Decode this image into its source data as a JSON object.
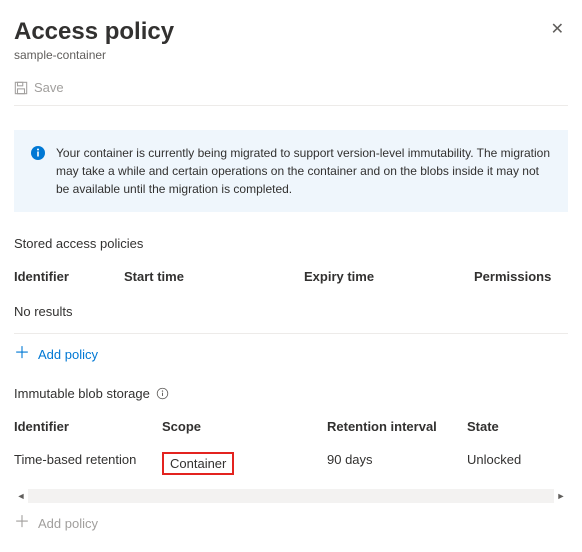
{
  "header": {
    "title": "Access policy",
    "subtitle": "sample-container"
  },
  "toolbar": {
    "save_label": "Save"
  },
  "notice": {
    "text": "Your container is currently being migrated to support version-level immutability. The migration may take a while and certain operations on the container and on the blobs inside it may not be available until the migration is completed."
  },
  "storedAccessPolicies": {
    "title": "Stored access policies",
    "columns": {
      "identifier": "Identifier",
      "start": "Start time",
      "expiry": "Expiry time",
      "permissions": "Permissions"
    },
    "no_results": "No results",
    "add_label": "Add policy"
  },
  "immutableBlobStorage": {
    "title": "Immutable blob storage",
    "columns": {
      "identifier": "Identifier",
      "scope": "Scope",
      "retention": "Retention interval",
      "state": "State"
    },
    "rows": [
      {
        "identifier": "Time-based retention",
        "scope": "Container",
        "retention": "90 days",
        "state": "Unlocked"
      }
    ],
    "add_label": "Add policy"
  }
}
